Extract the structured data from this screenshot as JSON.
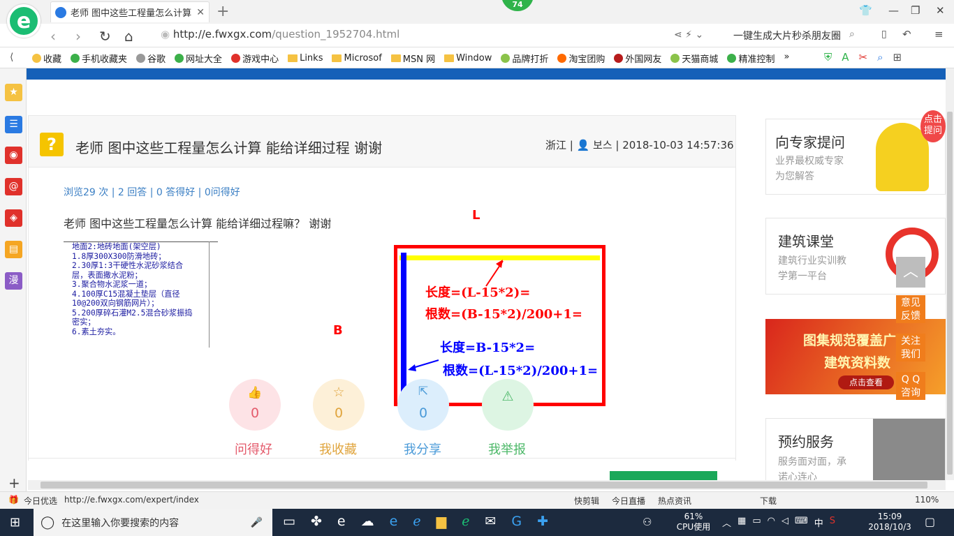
{
  "browser": {
    "tab_title": "老师 图中这些工程量怎么计算 能",
    "close_glyph": "✕",
    "new_tab_glyph": "+",
    "badge_count": "74",
    "url_host": "http://e.fwxgx.com",
    "url_path": "/question_1952704.html",
    "promo_text": "一键生成大片秒杀朋友圈",
    "bookmarks": [
      {
        "label": "收藏",
        "color": "#f5c242"
      },
      {
        "label": "手机收藏夹",
        "color": "#3cb04a"
      },
      {
        "label": "谷歌",
        "color": "#999999"
      },
      {
        "label": "网址大全",
        "color": "#3cb04a"
      },
      {
        "label": "游戏中心",
        "color": "#e0312b"
      },
      {
        "label": "Links",
        "color": "folder"
      },
      {
        "label": "Microsof",
        "color": "folder"
      },
      {
        "label": "MSN 网",
        "color": "folder"
      },
      {
        "label": "Window",
        "color": "folder"
      },
      {
        "label": "品牌打折",
        "color": "#8bc34a"
      },
      {
        "label": "淘宝团购",
        "color": "#ff6a00"
      },
      {
        "label": "外国网友",
        "color": "#b71c1c"
      },
      {
        "label": "天猫商城",
        "color": "#8bc34a"
      },
      {
        "label": "精准控制",
        "color": "#3cb04a"
      }
    ],
    "bookmarks_more": "»"
  },
  "question": {
    "title": "老师 图中这些工程量怎么计算 能给详细过程 谢谢",
    "meta": "浙江 | 👤 보스 | 2018-10-03 14:57:36",
    "stats": "浏览29 次 | 2 回答 | 0 答得好 | 0问得好",
    "body": "老师 图中这些工程量怎么计算 能给详细过程嘛？ 谢谢"
  },
  "spec_lines": [
    "地面2:地砖地面(架空层)",
    "1.8厚300X300防滑地砖；",
    "2.30厚1:3干硬性水泥砂浆结合",
    "层，表面撒水泥粉；",
    "3.聚合物水泥浆一道；",
    "4.100厚C15混凝土垫层（直径",
    "10@200双向钢筋网片）；",
    "5.200厚碎石灌M2.5混合砂浆振捣",
    "密实；",
    "6.素土夯实。"
  ],
  "diagram": {
    "label_L": "L",
    "label_B": "B",
    "red_len": "长度=(L-15*2)=",
    "red_cnt": "根数=(B-15*2)/200+1=",
    "blue_len": "长度=B-15*2=",
    "blue_cnt": "根数=(L-15*2)/200+1="
  },
  "actions": [
    {
      "label": "问得好",
      "count": "0",
      "icon": "thumbs-up-icon",
      "bg": "#fde3e6",
      "fg": "#e45b6c"
    },
    {
      "label": "我收藏",
      "count": "0",
      "icon": "star-icon",
      "bg": "#fdf0d8",
      "fg": "#e0a43c"
    },
    {
      "label": "我分享",
      "count": "0",
      "icon": "share-icon",
      "bg": "#dceefc",
      "fg": "#4a9ad8"
    },
    {
      "label": "我举报",
      "count": "",
      "icon": "warning-icon",
      "bg": "#ddf5e3",
      "fg": "#4cb868"
    }
  ],
  "right": {
    "expert_title": "向专家提问",
    "expert_sub1": "业界最权威专家",
    "expert_sub2": "为您解答",
    "expert_bubble": "点击提问",
    "class_title": "建筑课堂",
    "class_sub1": "建筑行业实训教",
    "class_sub2": "学第一平台",
    "banner_line1": "图集规范覆盖广",
    "banner_line2": "建筑资料数",
    "banner_btn": "点击查看",
    "booking_title": "预约服务",
    "booking_sub1": "服务面对面，承",
    "booking_sub2": "诺心连心"
  },
  "side_buttons": {
    "feedback": "意见反馈",
    "follow": "关注我们",
    "qq": "Q Q咨询"
  },
  "statusbar": {
    "left_label": "今日优选",
    "hover_url": "http://e.fwxgx.com/expert/index",
    "items": [
      "快剪辑",
      "今日直播",
      "热点资讯",
      "下载"
    ],
    "zoom": "110%"
  },
  "taskbar": {
    "search_placeholder": "在这里输入你要搜索的内容",
    "cpu_percent": "61%",
    "cpu_label": "CPU使用",
    "ime": "中",
    "time": "15:09",
    "date": "2018/10/3"
  }
}
